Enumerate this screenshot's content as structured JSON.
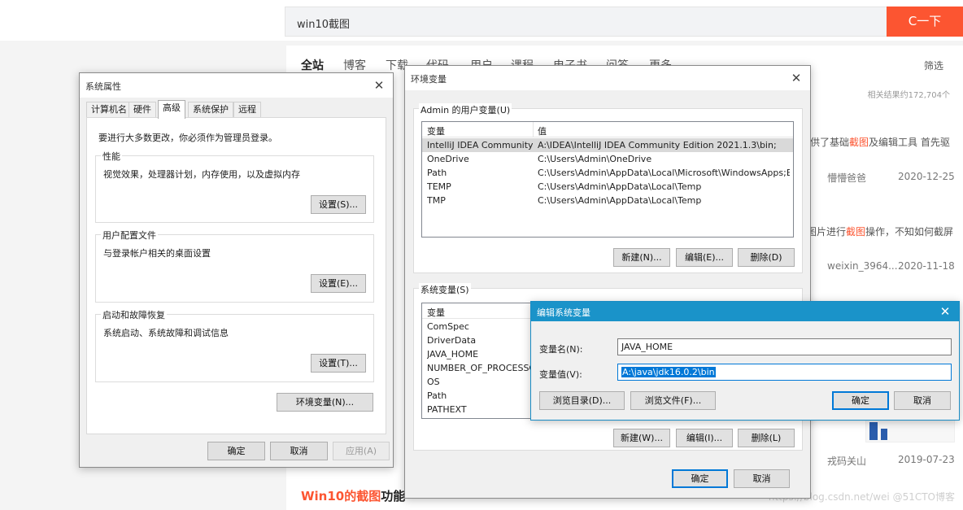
{
  "browser": {
    "search_query": "win10截图",
    "search_button": "C一下",
    "tabs": [
      "全站",
      "博客",
      "下载",
      "代码",
      "用户",
      "课程",
      "电子书",
      "问答",
      "更多"
    ],
    "filter": "筛选",
    "result_count": "相关结果约172,704个",
    "snippets": {
      "r1_text_a": "供了基础",
      "r1_text_hl": "截图",
      "r1_text_b": "及编辑工具 首先驱",
      "r1_author": "懵懵爸爸",
      "r1_date": "2020-12-25",
      "r2_text_a": "图片进行",
      "r2_text_hl": "截图",
      "r2_text_b": "操作，不知如何截屏",
      "r2_author": "weixin_3964...",
      "r2_date": "2020-11-18",
      "r3_author": "戎码关山",
      "r3_date": "2019-07-23",
      "last_title_a": "Win10",
      "last_title_hl": "的截图",
      "last_title_b": "功能",
      "watermark": "https://blog.csdn.net/wei @51CTO博客"
    }
  },
  "sysprops": {
    "title": "系统属性",
    "tabs": [
      "计算机名",
      "硬件",
      "高级",
      "系统保护",
      "远程"
    ],
    "active_tab": "高级",
    "admin_note": "要进行大多数更改，你必须作为管理员登录。",
    "performance": {
      "label": "性能",
      "desc": "视觉效果，处理器计划，内存使用，以及虚拟内存",
      "button": "设置(S)..."
    },
    "user_profiles": {
      "label": "用户配置文件",
      "desc": "与登录帐户相关的桌面设置",
      "button": "设置(E)..."
    },
    "startup": {
      "label": "启动和故障恢复",
      "desc": "系统启动、系统故障和调试信息",
      "button": "设置(T)..."
    },
    "env_button": "环境变量(N)...",
    "ok": "确定",
    "cancel": "取消",
    "apply": "应用(A)"
  },
  "envvars": {
    "title": "环境变量",
    "user_section": "Admin 的用户变量(U)",
    "col_var": "变量",
    "col_val": "值",
    "user_vars": [
      {
        "name": "IntelliJ IDEA Community E...",
        "value": "A:\\IDEA\\IntelliJ IDEA Community Edition 2021.1.3\\bin;"
      },
      {
        "name": "OneDrive",
        "value": "C:\\Users\\Admin\\OneDrive"
      },
      {
        "name": "Path",
        "value": "C:\\Users\\Admin\\AppData\\Local\\Microsoft\\WindowsApps;B:\\..."
      },
      {
        "name": "TEMP",
        "value": "C:\\Users\\Admin\\AppData\\Local\\Temp"
      },
      {
        "name": "TMP",
        "value": "C:\\Users\\Admin\\AppData\\Local\\Temp"
      }
    ],
    "user_buttons": {
      "new": "新建(N)...",
      "edit": "编辑(E)...",
      "delete": "删除(D)"
    },
    "sys_section": "系统变量(S)",
    "sys_vars": [
      "ComSpec",
      "DriverData",
      "JAVA_HOME",
      "NUMBER_OF_PROCESSORS",
      "OS",
      "Path",
      "PATHEXT"
    ],
    "sys_buttons": {
      "new": "新建(W)...",
      "edit": "编辑(I)...",
      "delete": "删除(L)"
    },
    "ok": "确定",
    "cancel": "取消"
  },
  "editvar": {
    "title": "编辑系统变量",
    "name_label": "变量名(N):",
    "name_value": "JAVA_HOME",
    "value_label": "变量值(V):",
    "value_value": "A:\\java\\jdk16.0.2\\bin",
    "browse_dir": "浏览目录(D)...",
    "browse_file": "浏览文件(F)...",
    "ok": "确定",
    "cancel": "取消",
    "title_bar_color": "#1a93c9"
  }
}
